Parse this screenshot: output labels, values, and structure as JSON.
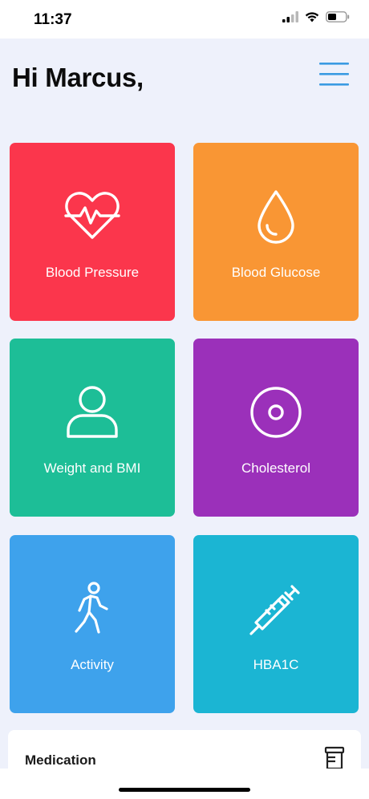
{
  "status_bar": {
    "time": "11:37"
  },
  "header": {
    "greeting": "Hi Marcus,"
  },
  "tiles": [
    {
      "label": "Blood Pressure",
      "color": "#fb364c",
      "icon": "heart-pulse-icon"
    },
    {
      "label": "Blood Glucose",
      "color": "#f99634",
      "icon": "drop-icon"
    },
    {
      "label": "Weight and BMI",
      "color": "#1dbe97",
      "icon": "person-icon"
    },
    {
      "label": "Cholesterol",
      "color": "#9b30ba",
      "icon": "cholesterol-circle-icon"
    },
    {
      "label": "Activity",
      "color": "#3ea2ec",
      "icon": "walking-icon"
    },
    {
      "label": "HBA1C",
      "color": "#1bb5d3",
      "icon": "syringe-icon"
    }
  ],
  "medication": {
    "title": "Medication",
    "icon": "pill-bottle-icon"
  },
  "colors": {
    "background": "#eef1fb",
    "accent": "#3b9be2"
  }
}
